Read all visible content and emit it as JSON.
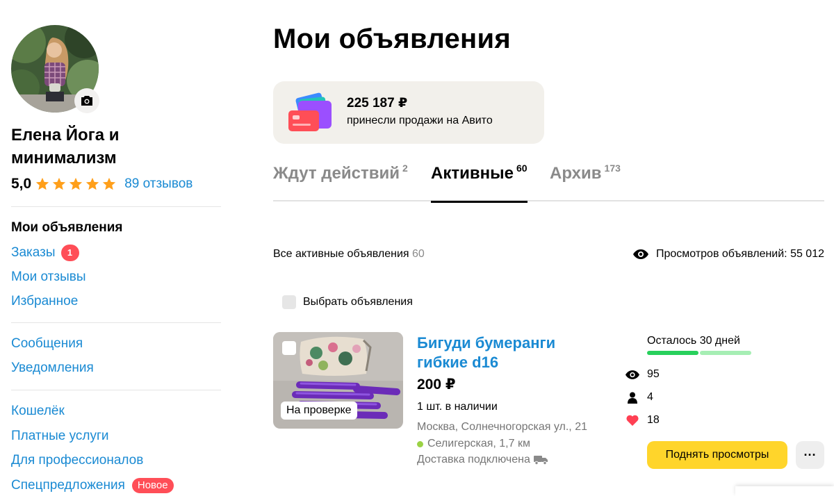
{
  "profile": {
    "name": "Елена Йога и минимализм",
    "rating": "5,0",
    "stars": 5,
    "reviews": "89 отзывов"
  },
  "sidebar": {
    "section_title": "Мои объявления",
    "group1": [
      {
        "label": "Заказы",
        "badge": "1"
      },
      {
        "label": "Мои отзывы"
      },
      {
        "label": "Избранное"
      }
    ],
    "group2": [
      {
        "label": "Сообщения"
      },
      {
        "label": "Уведомления"
      }
    ],
    "group3": [
      {
        "label": "Кошелёк"
      },
      {
        "label": "Платные услуги"
      },
      {
        "label": "Для профессионалов"
      },
      {
        "label": "Спецпредложения",
        "badge": "Новое"
      }
    ]
  },
  "main": {
    "title": "Мои объявления",
    "earnings": {
      "amount": "225 187 ₽",
      "caption": "принесли продажи на Авито"
    },
    "tabs": [
      {
        "label": "Ждут действий",
        "count": "2",
        "active": false
      },
      {
        "label": "Активные",
        "count": "60",
        "active": true
      },
      {
        "label": "Архив",
        "count": "173",
        "active": false
      }
    ],
    "filter": {
      "all_active_label": "Все активные объявления",
      "all_active_count": "60",
      "views_total": "Просмотров объявлений: 55 012",
      "select_label": "Выбрать объявления"
    },
    "listing": {
      "title": "Бигуди бумеранги гибкие d16",
      "price": "200 ₽",
      "stock": "1 шт. в наличии",
      "address": "Москва, Солнечногорская ул., 21",
      "metro": "Селигерская, 1,7 км",
      "delivery": "Доставка подключена",
      "photo_badge": "На проверке",
      "days_left": "Осталось 30 дней",
      "days_progress": 0.5,
      "views": "95",
      "contacts": "4",
      "favorites": "18",
      "boost_button": "Поднять просмотры",
      "more_button": "···"
    }
  },
  "colors": {
    "link": "#1a8ad3",
    "star": "#ff9f1a",
    "badge": "#ff4e57",
    "accent_button": "#ffd52b",
    "progress": "#28d05c",
    "progress_rest": "#a6eeb4",
    "heart": "#ff4053",
    "metro_line": "#9bd245"
  },
  "icons": [
    "camera-icon",
    "star-icon",
    "wallet-cards-icon",
    "eye-icon",
    "user-icon",
    "heart-icon",
    "truck-icon"
  ]
}
